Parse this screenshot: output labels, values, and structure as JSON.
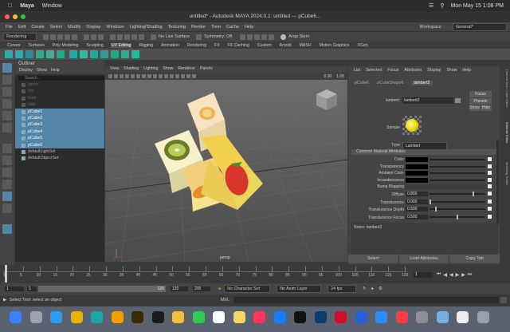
{
  "macmenu": {
    "app": "Maya",
    "window": "Window",
    "datetime": "Mon May 15  1:08 PM"
  },
  "window": {
    "title": "untitled* - Autodesk MAYA 2024.0.1: untitled  ---  pCube6..."
  },
  "mainmenu": {
    "items": [
      "File",
      "Edit",
      "Create",
      "Select",
      "Modify",
      "Display",
      "Windows",
      "Lighting/Shading",
      "Texturing",
      "Render",
      "Toon",
      "Cache",
      "Help"
    ],
    "workspace_label": "Workspace :",
    "workspace_value": "General*"
  },
  "statusline": {
    "mode": "Rendering",
    "live": "No Live Surface",
    "symmetry": "Symmetry: Off",
    "user": "Arqa Sterri"
  },
  "shelf": {
    "tabs": [
      "Curves",
      "Surfaces",
      "Poly Modeling",
      "Sculpting",
      "UV Editing",
      "Rigging",
      "Animation",
      "Rendering",
      "FX",
      "FX Caching",
      "Custom",
      "Arnold",
      "MASH",
      "Motion Graphics",
      "XGen"
    ],
    "active": "UV Editing"
  },
  "outliner": {
    "title": "Outliner",
    "menu": [
      "Display",
      "Show",
      "Help"
    ],
    "search_placeholder": "Search...",
    "items": [
      {
        "label": "persp",
        "state": "dim"
      },
      {
        "label": "top",
        "state": "dim"
      },
      {
        "label": "front",
        "state": "dim"
      },
      {
        "label": "side",
        "state": "dim"
      },
      {
        "label": "pCube1",
        "state": "sel"
      },
      {
        "label": "pCube2",
        "state": "sel"
      },
      {
        "label": "pCube3",
        "state": "sel"
      },
      {
        "label": "pCube4",
        "state": "sel"
      },
      {
        "label": "pCube5",
        "state": "sel"
      },
      {
        "label": "pCube6",
        "state": "sel"
      },
      {
        "label": "defaultLightSet",
        "state": "normal"
      },
      {
        "label": "defaultObjectSet",
        "state": "normal"
      }
    ]
  },
  "viewport": {
    "menu": [
      "View",
      "Shading",
      "Lighting",
      "Show",
      "Renderer",
      "Panels"
    ],
    "camera_label": "persp",
    "exposure": "0.00",
    "gamma": "1.00"
  },
  "attribute_editor": {
    "menu": [
      "List",
      "Selected",
      "Focus",
      "Attributes",
      "Display",
      "Show",
      "Help"
    ],
    "tabs": [
      "pCube6",
      "pCubeShape6",
      "lambert2"
    ],
    "active_tab": "lambert2",
    "node_label": "lambert:",
    "node_value": "lambert2",
    "focus": "Focus",
    "presets": "Presets",
    "show": "Show",
    "hide": "Hide",
    "sample_label": "Sample",
    "type_label": "Type",
    "type_value": "Lambert",
    "section": "Common Material Attributes",
    "color_attrs": [
      "Color",
      "Transparency",
      "Ambient Color",
      "Incandescence"
    ],
    "bump_label": "Bump Mapping",
    "num_attrs": [
      {
        "label": "Diffuse",
        "value": "0.800",
        "fill": 0.8
      },
      {
        "label": "Translucence",
        "value": "0.000",
        "fill": 0.0
      },
      {
        "label": "Translucence Depth",
        "value": "0.500",
        "fill": 0.1
      },
      {
        "label": "Translucence Focus",
        "value": "0.500",
        "fill": 0.5
      }
    ],
    "notes": "Notes:  lambert2",
    "buttons": [
      "Select",
      "Load Attributes",
      "Copy Tab"
    ]
  },
  "side_tabs": [
    "Channel Box / Layer Editor",
    "Attribute Editor",
    "Modeling Toolkit"
  ],
  "timeslider": {
    "ticks": [
      "1",
      "5",
      "10",
      "15",
      "20",
      "25",
      "30",
      "35",
      "40",
      "45",
      "50",
      "55",
      "60",
      "65",
      "70",
      "75",
      "80",
      "85",
      "90",
      "95",
      "100",
      "105",
      "110",
      "115",
      "120"
    ],
    "current": "1"
  },
  "range": {
    "start": "1",
    "start_inner": "1",
    "end_inner": "120",
    "end_outer": "120",
    "end2": "200",
    "character_set": "No Character Set",
    "anim_layer": "No Anim Layer",
    "fps": "24 fps"
  },
  "cmdline": {
    "lang": "MEL",
    "help": "Select Tool: select an object"
  },
  "colors": {
    "selection": "#5285a6",
    "panel": "#444444",
    "dark": "#2b2b2b"
  },
  "dock_icons": [
    "finder-icon",
    "launchpad-icon",
    "safari-icon",
    "chrome-icon",
    "maya-icon",
    "nuke-icon",
    "illustrator-icon",
    "app-icon",
    "photos-icon",
    "messages-icon",
    "calendar-icon",
    "notes-icon",
    "news-icon",
    "appstore-icon",
    "tv-icon",
    "photoshop-icon",
    "acrobat-icon",
    "vpn-icon",
    "zoom-icon",
    "music-icon",
    "settings-icon",
    "preview-icon",
    "textedit-icon",
    "trash-icon"
  ]
}
